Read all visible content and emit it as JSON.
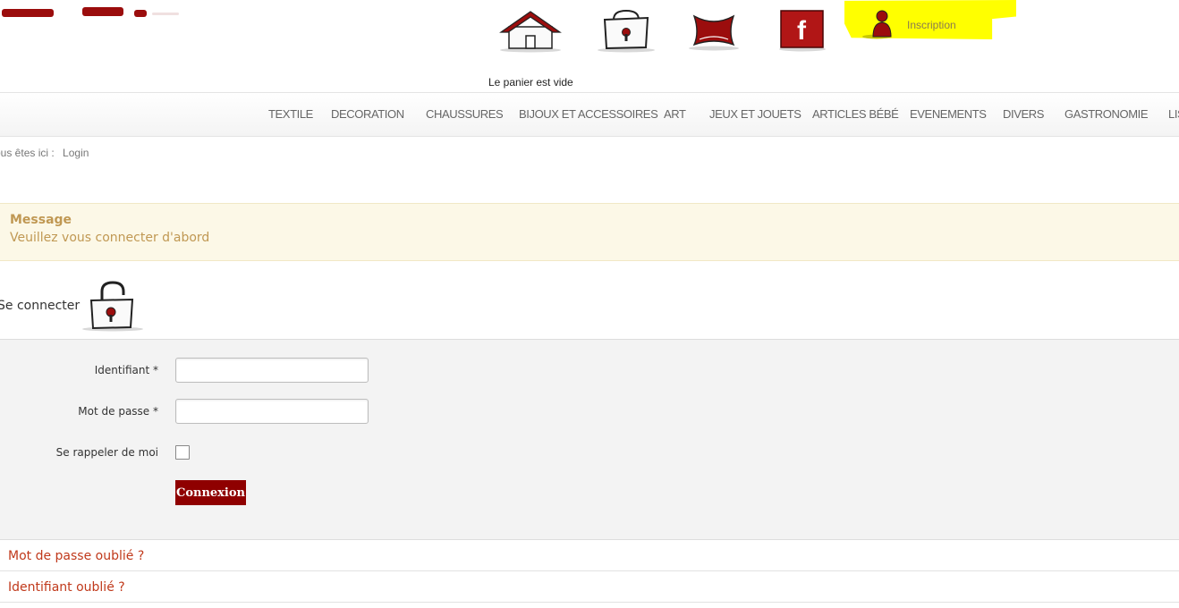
{
  "header": {
    "icons": {
      "home": "home-icon",
      "cart": "shopping-bag-icon",
      "catalog": "red-cushion-icon",
      "facebook": "facebook-icon",
      "user": "user-icon"
    },
    "facebook_glyph": "f",
    "inscription_label": "Inscription",
    "cart_status": "Le panier est vide",
    "brand_color": "#9b0d0d",
    "highlight_color": "#ffff00"
  },
  "nav": {
    "items": [
      "TEXTILE",
      "DECORATION",
      "CHAUSSURES",
      "BIJOUX ET ACCESSOIRES",
      "ART",
      "JEUX ET JOUETS",
      "ARTICLES BÉBÉ",
      "EVENEMENTS",
      "DIVERS",
      "GASTRONOMIE",
      "LIS"
    ]
  },
  "breadcrumb": {
    "prefix": "ous êtes ici :",
    "current": "Login"
  },
  "message": {
    "title": "Message",
    "text": "Veuillez vous connecter d'abord",
    "background": "#fcf8e7",
    "text_color": "#c09853"
  },
  "login": {
    "heading": "Se connecter",
    "heading_icon": "padlock-icon",
    "fields": {
      "username_label": "Identifiant *",
      "username_value": "",
      "password_label": "Mot de passe *",
      "password_value": "",
      "remember_label": "Se rappeler de moi",
      "remember_checked": false
    },
    "submit_label": "Connexion",
    "submit_color": "#8f0000"
  },
  "links": {
    "forgot_password": "Mot de passe oublié ?",
    "forgot_username": "Identifiant oublié ?",
    "link_color": "#c0391b"
  }
}
